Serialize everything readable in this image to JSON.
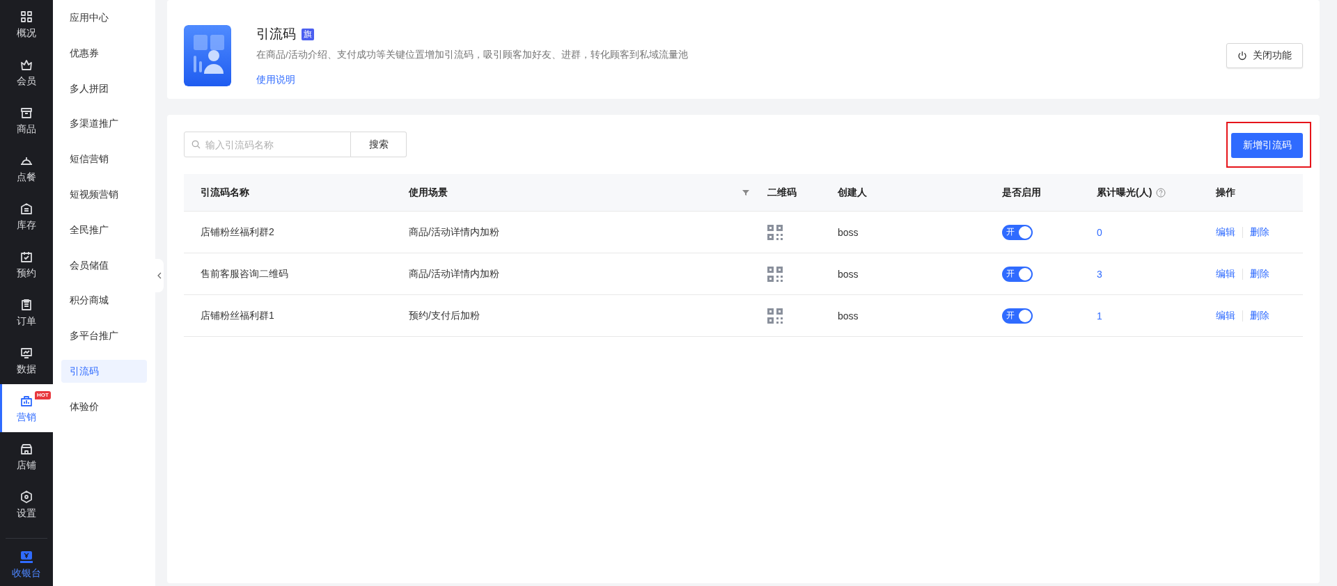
{
  "nav": {
    "items": [
      {
        "label": "概况",
        "selected": false,
        "hot": false
      },
      {
        "label": "会员",
        "selected": false,
        "hot": false
      },
      {
        "label": "商品",
        "selected": false,
        "hot": false
      },
      {
        "label": "点餐",
        "selected": false,
        "hot": false
      },
      {
        "label": "库存",
        "selected": false,
        "hot": false
      },
      {
        "label": "预约",
        "selected": false,
        "hot": false
      },
      {
        "label": "订单",
        "selected": false,
        "hot": false
      },
      {
        "label": "数据",
        "selected": false,
        "hot": false
      },
      {
        "label": "营销",
        "selected": true,
        "hot": true,
        "badge": "HOT"
      },
      {
        "label": "店铺",
        "selected": false,
        "hot": false
      },
      {
        "label": "设置",
        "selected": false,
        "hot": false
      }
    ],
    "cashier": {
      "label": "收银台"
    }
  },
  "sidebar": {
    "items": [
      {
        "label": "应用中心",
        "selected": false
      },
      {
        "label": "优惠券",
        "selected": false
      },
      {
        "label": "多人拼团",
        "selected": false
      },
      {
        "label": "多渠道推广",
        "selected": false
      },
      {
        "label": "短信营销",
        "selected": false
      },
      {
        "label": "短视频营销",
        "selected": false
      },
      {
        "label": "全民推广",
        "selected": false
      },
      {
        "label": "会员储值",
        "selected": false
      },
      {
        "label": "积分商城",
        "selected": false
      },
      {
        "label": "多平台推广",
        "selected": false
      },
      {
        "label": "引流码",
        "selected": true
      },
      {
        "label": "体验价",
        "selected": false
      }
    ]
  },
  "header": {
    "title": "引流码",
    "badge": "旗",
    "description": "在商品/活动介绍、支付成功等关键位置增加引流码，吸引顾客加好友、进群，转化顾客到私域流量池",
    "help_link": "使用说明",
    "close_button": "关闭功能"
  },
  "toolbar": {
    "search": {
      "placeholder": "输入引流码名称"
    },
    "search_button": "搜索",
    "add_button": "新增引流码"
  },
  "table": {
    "columns": [
      "引流码名称",
      "使用场景",
      "二维码",
      "创建人",
      "是否启用",
      "累计曝光(人)",
      "操作"
    ],
    "rows": [
      {
        "name": "店铺粉丝福利群2",
        "scene": "商品/活动详情内加粉",
        "creator": "boss",
        "toggle_label": "开",
        "enabled": true,
        "exposure": "0",
        "actions": [
          "编辑",
          "删除"
        ]
      },
      {
        "name": "售前客服咨询二维码",
        "scene": "商品/活动详情内加粉",
        "creator": "boss",
        "toggle_label": "开",
        "enabled": true,
        "exposure": "3",
        "actions": [
          "编辑",
          "删除"
        ]
      },
      {
        "name": "店铺粉丝福利群1",
        "scene": "预约/支付后加粉",
        "creator": "boss",
        "toggle_label": "开",
        "enabled": true,
        "exposure": "1",
        "actions": [
          "编辑",
          "删除"
        ]
      }
    ]
  }
}
